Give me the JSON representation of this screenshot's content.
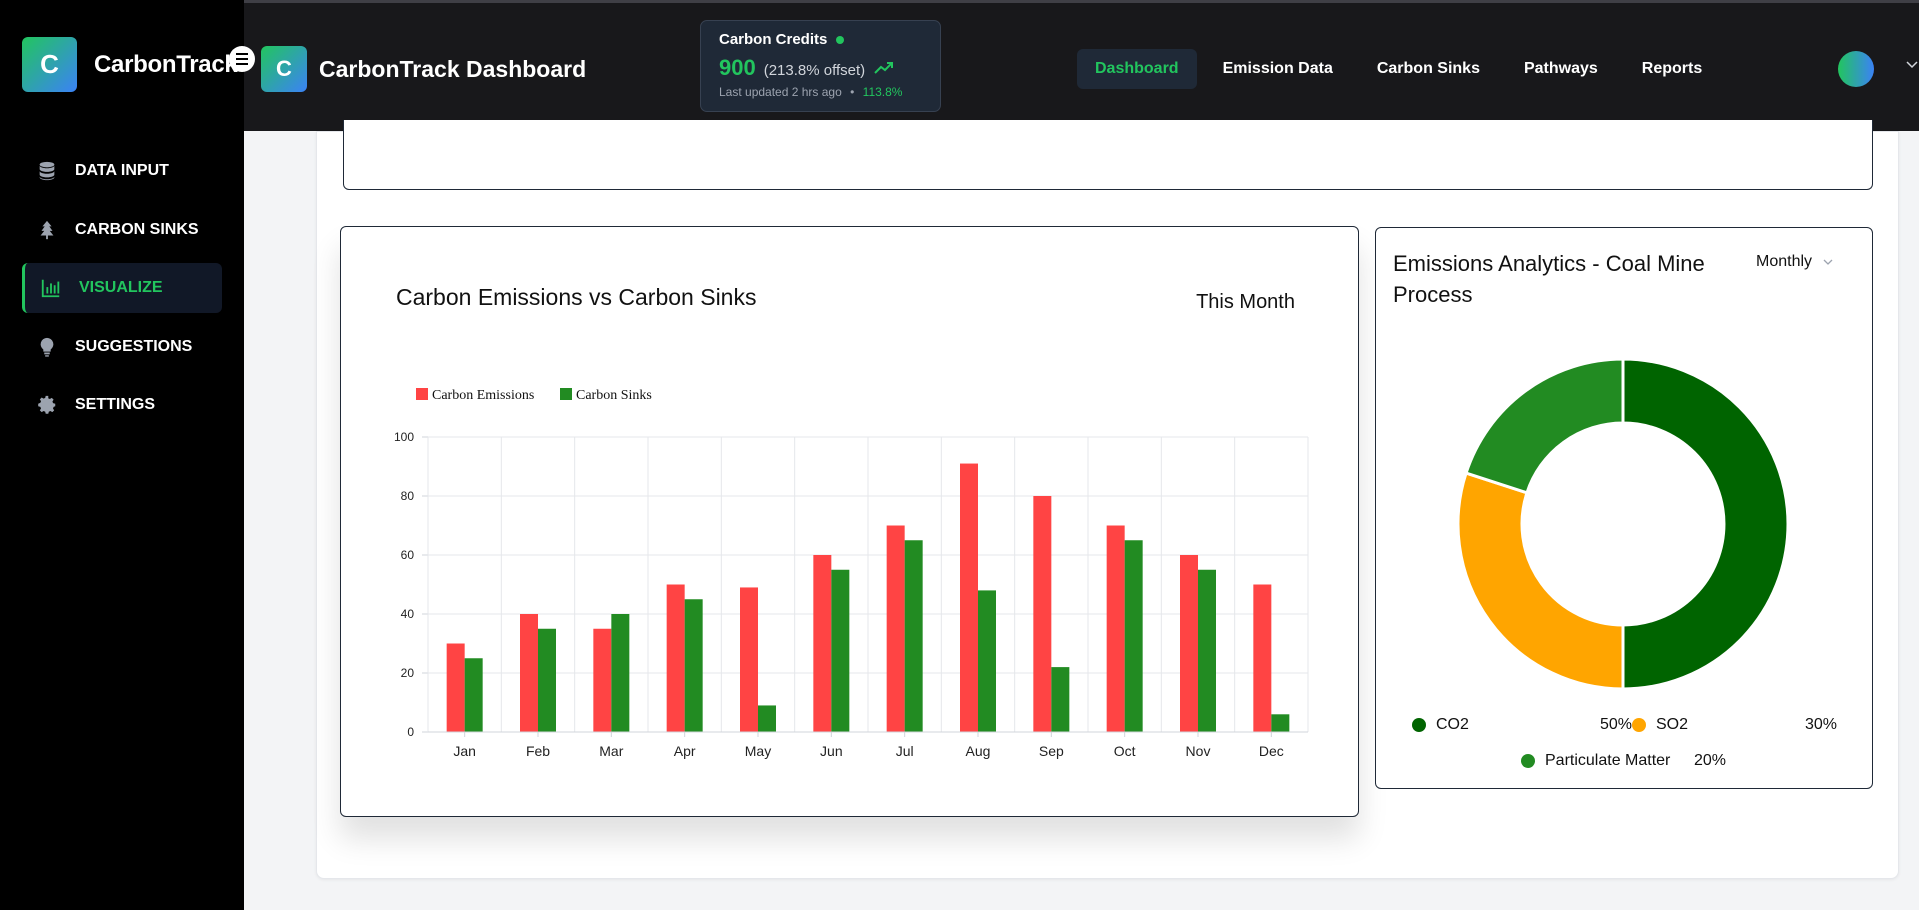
{
  "sidebar": {
    "brand_letter": "C",
    "brand_name": "CarbonTrack",
    "items": [
      {
        "label": "DATA INPUT",
        "icon": "database-icon"
      },
      {
        "label": "CARBON SINKS",
        "icon": "tree-icon"
      },
      {
        "label": "VISUALIZE",
        "icon": "bar-chart-icon",
        "active": true
      },
      {
        "label": "SUGGESTIONS",
        "icon": "lightbulb-icon"
      },
      {
        "label": "SETTINGS",
        "icon": "gear-icon"
      }
    ]
  },
  "header": {
    "logo_letter": "C",
    "title": "CarbonTrack Dashboard",
    "credits": {
      "title": "Carbon Credits",
      "value": "900",
      "offset": "(213.8% offset)",
      "updated": "Last updated 2 hrs ago",
      "separator": "•",
      "change": "113.8%"
    },
    "nav": [
      "Dashboard",
      "Emission Data",
      "Carbon Sinks",
      "Pathways",
      "Reports"
    ],
    "active_nav": "Dashboard"
  },
  "colors": {
    "accent": "#22c55e",
    "emissions": "#ff4444",
    "sinks": "#228b22",
    "co2": "#006400",
    "so2": "#ffa500",
    "particulate": "#228b22"
  },
  "emissions_chart": {
    "title": "Carbon Emissions vs Carbon Sinks",
    "period": "This Month"
  },
  "analytics": {
    "title": "Emissions Analytics - Coal Mine Process",
    "period_select": "Monthly",
    "legend": [
      {
        "name": "CO2",
        "pct": "50%"
      },
      {
        "name": "SO2",
        "pct": "30%"
      },
      {
        "name": "Particulate Matter",
        "pct": "20%"
      }
    ]
  },
  "chart_data": [
    {
      "type": "bar",
      "title": "Carbon Emissions vs Carbon Sinks",
      "categories": [
        "Jan",
        "Feb",
        "Mar",
        "Apr",
        "May",
        "Jun",
        "Jul",
        "Aug",
        "Sep",
        "Oct",
        "Nov",
        "Dec"
      ],
      "series": [
        {
          "name": "Carbon Emissions",
          "color": "#ff4444",
          "values": [
            30,
            40,
            35,
            50,
            49,
            60,
            70,
            91,
            80,
            70,
            60,
            50
          ]
        },
        {
          "name": "Carbon Sinks",
          "color": "#228b22",
          "values": [
            25,
            35,
            40,
            45,
            9,
            55,
            65,
            48,
            22,
            65,
            55,
            6
          ]
        }
      ],
      "y_ticks": [
        "0",
        "20",
        "40",
        "60",
        "80",
        "100"
      ],
      "ylim": [
        0,
        100
      ],
      "legend": "top-left",
      "grid": true
    },
    {
      "type": "pie",
      "title": "Emissions Analytics - Coal Mine Process",
      "slices": [
        {
          "name": "CO2",
          "value": 50,
          "color": "#006400"
        },
        {
          "name": "SO2",
          "value": 30,
          "color": "#ffa500"
        },
        {
          "name": "Particulate Matter",
          "value": 20,
          "color": "#228b22"
        }
      ]
    }
  ]
}
